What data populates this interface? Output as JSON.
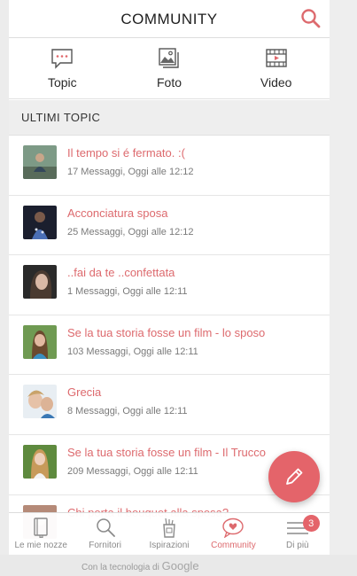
{
  "header": {
    "title": "COMMUNITY"
  },
  "categories": [
    {
      "label": "Topic",
      "icon": "chat-bubble-icon"
    },
    {
      "label": "Foto",
      "icon": "photos-icon"
    },
    {
      "label": "Video",
      "icon": "film-icon"
    }
  ],
  "section": {
    "title": "ULTIMI TOPIC"
  },
  "topics": [
    {
      "title": "Il tempo si é fermato. :(",
      "meta": "17 Messaggi, Oggi alle 12:12"
    },
    {
      "title": "Acconciatura sposa",
      "meta": "25 Messaggi, Oggi alle 12:12"
    },
    {
      "title": "..fai da te ..confettata",
      "meta": "1 Messaggi, Oggi alle 12:11"
    },
    {
      "title": "Se la tua storia fosse un film - lo sposo",
      "meta": "103 Messaggi, Oggi alle 12:11"
    },
    {
      "title": "Grecia",
      "meta": "8 Messaggi, Oggi alle 12:11"
    },
    {
      "title": "Se la tua storia fosse un film - Il Trucco",
      "meta": "209 Messaggi, Oggi alle 12:11"
    },
    {
      "title": "Chi porta il bouquet alla sposa?",
      "meta": ""
    }
  ],
  "tabs": [
    {
      "label": "Le mie nozze",
      "icon": "book-icon"
    },
    {
      "label": "Fornitori",
      "icon": "search-icon"
    },
    {
      "label": "Ispirazioni",
      "icon": "ideas-icon"
    },
    {
      "label": "Community",
      "icon": "heart-chat-icon"
    },
    {
      "label": "Di più",
      "icon": "menu-icon",
      "badge": "3"
    }
  ],
  "background": {
    "footer_note": "Con la tecnologia di",
    "brand": "Google"
  },
  "colors": {
    "accent": "#dd6a6e",
    "fab": "#e4646a"
  }
}
